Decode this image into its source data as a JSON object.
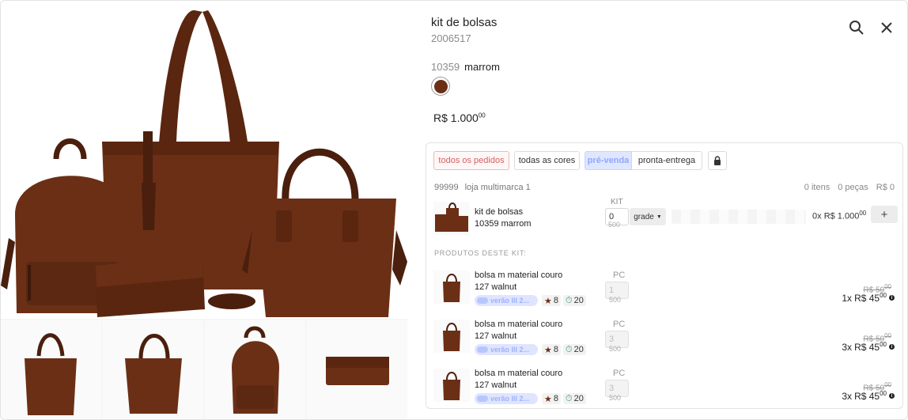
{
  "product": {
    "title": "kit de bolsas",
    "code": "2006517",
    "color_code": "10359",
    "color_name": "marrom",
    "swatch_color": "#6b2f16",
    "price_main": "R$ 1.000",
    "price_cents": "00"
  },
  "toolbar": {
    "search_icon": "search-icon",
    "close_icon": "close-icon"
  },
  "filters": {
    "all_orders": "todos os pedidos",
    "all_colors": "todas as cores",
    "pre_sale": "pré-venda",
    "ready_delivery": "pronta-entrega",
    "lock_icon": "lock-icon"
  },
  "store": {
    "id": "99999",
    "name": "loja multimarca 1"
  },
  "totals": {
    "items": "0 itens",
    "pieces": "0 peças",
    "value": "R$ 0"
  },
  "kit_row": {
    "label": "KIT",
    "name": "kit de bolsas",
    "sub": "10359 marrom",
    "qty": "0",
    "qty_max": "500",
    "grade": "grade",
    "total_prefix": "0x",
    "total_price": "R$ 1.000",
    "total_cents": "00",
    "add": "+"
  },
  "section_label": "PRODUTOS DESTE KIT:",
  "kit_products": [
    {
      "name": "bolsa m material couro",
      "sub": "127 walnut",
      "collection": "verão III 2...",
      "stars": "8",
      "timer": "20",
      "pc_label": "PC",
      "qty": "1",
      "qty_max": "500",
      "old_price": "R$ 50",
      "old_cents": "00",
      "mult": "1x",
      "price": "R$ 45",
      "cents": "00"
    },
    {
      "name": "bolsa m material couro",
      "sub": "127 walnut",
      "collection": "verão III 2...",
      "stars": "8",
      "timer": "20",
      "pc_label": "PC",
      "qty": "3",
      "qty_max": "500",
      "old_price": "R$ 50",
      "old_cents": "00",
      "mult": "3x",
      "price": "R$ 45",
      "cents": "00"
    },
    {
      "name": "bolsa m material couro",
      "sub": "127 walnut",
      "collection": "verão III 2...",
      "stars": "8",
      "timer": "20",
      "pc_label": "PC",
      "qty": "3",
      "qty_max": "500",
      "old_price": "R$ 50",
      "old_cents": "00",
      "mult": "3x",
      "price": "R$ 45",
      "cents": "00"
    }
  ],
  "colors": {
    "leather": "#6b2f16",
    "leather_dark": "#4a1f0d",
    "accent_red": "#d46060",
    "accent_blue": "#8fa6ff"
  }
}
